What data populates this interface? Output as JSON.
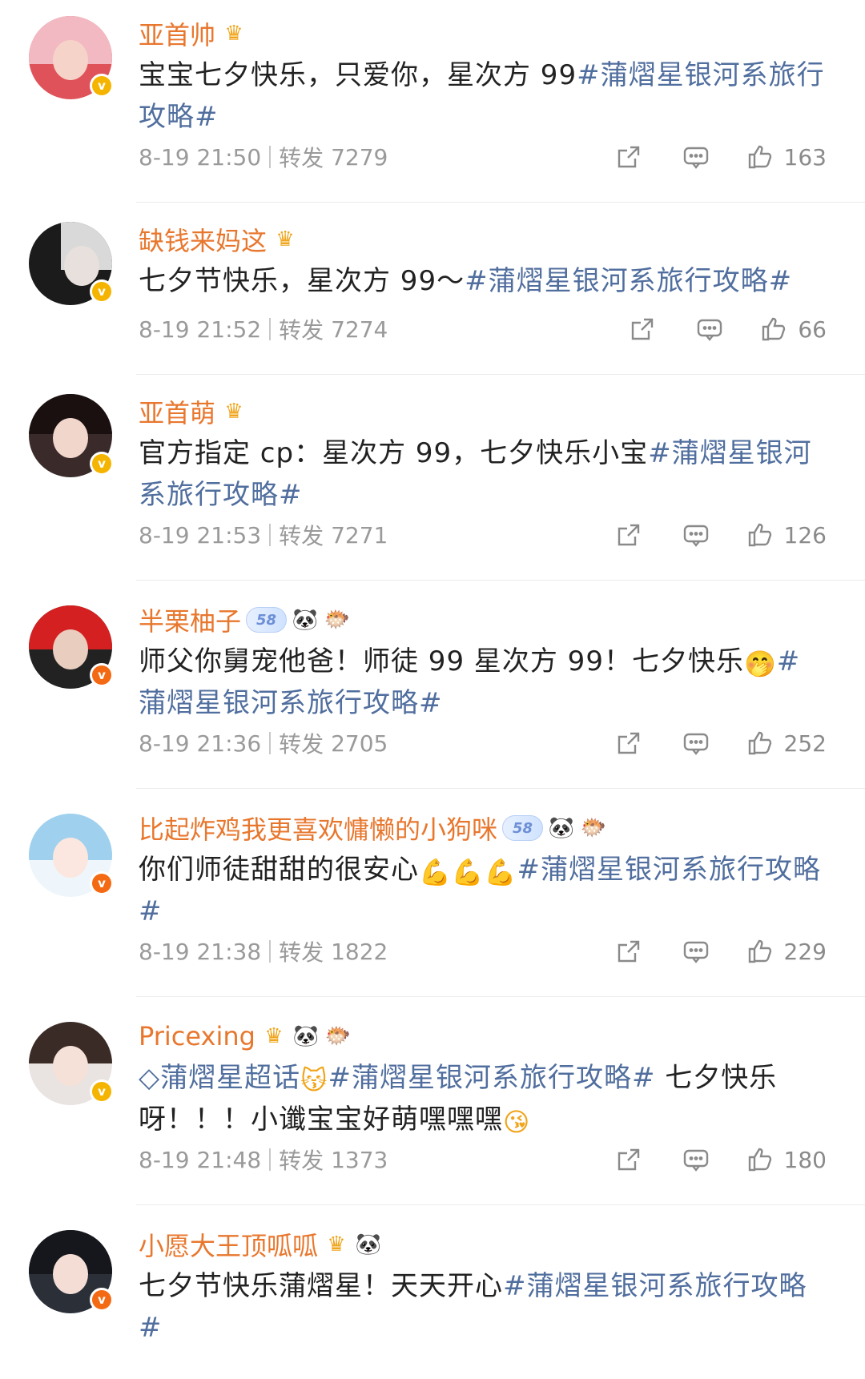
{
  "posts": [
    {
      "username": "亚首帅",
      "badges": [
        "crown"
      ],
      "text": [
        {
          "t": "宝宝七夕快乐，只爱你，星次方 99"
        },
        {
          "t": "#蒲熠星银河系旅行攻略#",
          "tag": true
        }
      ],
      "time": "8-19 21:50",
      "repost_label": "转发",
      "repost": "7279",
      "likes": "163",
      "verify": "gold"
    },
    {
      "username": "缺钱来妈这",
      "badges": [
        "crown"
      ],
      "text": [
        {
          "t": "七夕节快乐，星次方 99～"
        },
        {
          "t": "#蒲熠星银河系旅行攻略#",
          "tag": true
        }
      ],
      "time": "8-19 21:52",
      "repost_label": "转发",
      "repost": "7274",
      "likes": "66",
      "verify": "gold"
    },
    {
      "username": "亚首萌",
      "badges": [
        "crown"
      ],
      "text": [
        {
          "t": "官方指定 cp：星次方 99，七夕快乐小宝"
        },
        {
          "t": "#蒲熠星银河系旅行攻略#",
          "tag": true
        }
      ],
      "time": "8-19 21:53",
      "repost_label": "转发",
      "repost": "7271",
      "likes": "126",
      "verify": "gold"
    },
    {
      "username": "半栗柚子",
      "badges": [
        "level",
        "panda",
        "fish"
      ],
      "level": "58",
      "text": [
        {
          "t": "师父你舅宠他爸！师徒 99 星次方 99！七夕快乐"
        },
        {
          "t": "🤭",
          "emo": true
        },
        {
          "t": "#蒲熠星银河系旅行攻略#",
          "tag": true
        }
      ],
      "time": "8-19 21:36",
      "repost_label": "转发",
      "repost": "2705",
      "likes": "252",
      "verify": "orange"
    },
    {
      "username": "比起炸鸡我更喜欢慵懒的小狗咪",
      "badges": [
        "level",
        "panda",
        "fish"
      ],
      "level": "58",
      "text": [
        {
          "t": "你们师徒甜甜的很安心"
        },
        {
          "t": "💪💪💪",
          "emo": true
        },
        {
          "t": "#蒲熠星银河系旅行攻略#",
          "tag": true
        }
      ],
      "time": "8-19 21:38",
      "repost_label": "转发",
      "repost": "1822",
      "likes": "229",
      "verify": "orange"
    },
    {
      "username": "Pricexing",
      "badges": [
        "crown",
        "panda",
        "fish"
      ],
      "text": [
        {
          "t": "◇蒲熠星超话",
          "tag": true
        },
        {
          "t": "😽",
          "emo": true
        },
        {
          "t": "#蒲熠星银河系旅行攻略#",
          "tag": true
        },
        {
          "t": " 七夕快乐呀！！！小谶宝宝好萌嘿嘿嘿"
        },
        {
          "t": "😘",
          "emo": true
        }
      ],
      "time": "8-19 21:48",
      "repost_label": "转发",
      "repost": "1373",
      "likes": "180",
      "verify": "gold"
    },
    {
      "username": "小愿大王顶呱呱",
      "badges": [
        "crown",
        "panda"
      ],
      "text": [
        {
          "t": "七夕节快乐蒲熠星！天天开心"
        },
        {
          "t": "#蒲熠星银河系旅行攻略#",
          "tag": true
        }
      ],
      "verify": "orange"
    }
  ],
  "icons": {
    "crown": "crown-icon",
    "panda": "panda-icon",
    "fish": "fish-icon",
    "share": "share-icon",
    "comment": "comment-icon",
    "like": "thumbs-up-icon"
  },
  "colors": {
    "username": "#e8772e",
    "hashtag": "#506e9e",
    "meta": "#9a9a9a",
    "verify_gold": "#f5b400",
    "verify_orange": "#f46a14"
  }
}
